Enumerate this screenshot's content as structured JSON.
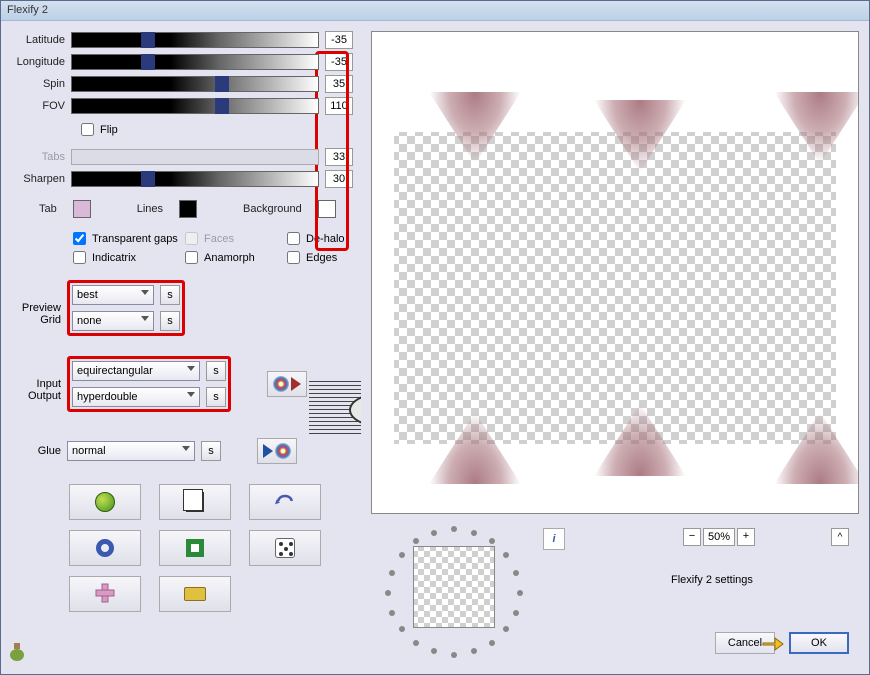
{
  "window": {
    "title": "Flexify 2"
  },
  "sliders": {
    "latitude": {
      "label": "Latitude",
      "value": "-35",
      "thumb": 28
    },
    "longitude": {
      "label": "Longitude",
      "value": "-35",
      "thumb": 28
    },
    "spin": {
      "label": "Spin",
      "value": "35",
      "thumb": 58
    },
    "fov": {
      "label": "FOV",
      "value": "110",
      "thumb": 58
    },
    "tabs": {
      "label": "Tabs",
      "value": "33",
      "thumb": 0,
      "disabled": true
    },
    "sharpen": {
      "label": "Sharpen",
      "value": "30",
      "thumb": 28
    }
  },
  "flip": {
    "label": "Flip",
    "checked": false
  },
  "colors": {
    "tab_label": "Tab",
    "tab_swatch": "#d9b8d8",
    "lines_label": "Lines",
    "lines_swatch": "#000000",
    "background_label": "Background",
    "background_swatch": "#ffffff"
  },
  "checks": {
    "transparent_gaps": {
      "label": "Transparent gaps",
      "checked": true
    },
    "faces": {
      "label": "Faces",
      "checked": false,
      "disabled": true
    },
    "dehalo": {
      "label": "De-halo",
      "checked": false
    },
    "indicatrix": {
      "label": "Indicatrix",
      "checked": false
    },
    "anamorph": {
      "label": "Anamorph",
      "checked": false
    },
    "edges": {
      "label": "Edges",
      "checked": false
    }
  },
  "combos": {
    "preview": {
      "label": "Preview",
      "value": "best"
    },
    "grid": {
      "label": "Grid",
      "value": "none"
    },
    "input": {
      "label": "Input",
      "value": "equirectangular"
    },
    "output": {
      "label": "Output",
      "value": "hyperdouble"
    },
    "glue": {
      "label": "Glue",
      "value": "normal"
    }
  },
  "bottom": {
    "zoom": "50%",
    "settings_label": "Flexify 2 settings",
    "cancel": "Cancel",
    "ok": "OK"
  },
  "info": "i",
  "s": "s",
  "zoom_minus": "−",
  "zoom_plus": "+",
  "caret": "^"
}
